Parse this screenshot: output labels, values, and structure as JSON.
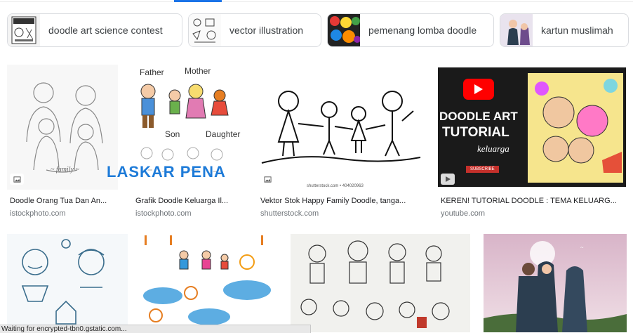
{
  "chips": [
    {
      "label": "doodle art science contest"
    },
    {
      "label": "vector illustration"
    },
    {
      "label": "pemenang lomba doodle"
    },
    {
      "label": "kartun muslimah"
    }
  ],
  "row1": [
    {
      "caption": "Doodle Orang Tua Dan An...",
      "source": "istockphoto.com",
      "badge": "image-icon"
    },
    {
      "caption": "Grafik Doodle Keluarga Il...",
      "source": "istockphoto.com",
      "overlay": "LASKAR PENA",
      "labels": {
        "father": "Father",
        "mother": "Mother",
        "son": "Son",
        "daughter": "Daughter"
      }
    },
    {
      "caption": "Vektor Stok Happy Family Doodle, tanga...",
      "source": "shutterstock.com",
      "badge": "image-icon",
      "stock_mark": "shutterstock.com • 404020963"
    },
    {
      "caption": "KEREN! TUTORIAL DOODLE : TEMA KELUARG...",
      "source": "youtube.com",
      "badge": "play-icon",
      "thumb": {
        "line1": "DOODLE ART",
        "line2": "TUTORIAL",
        "line3": "keluarga",
        "subscribe": "SUBSCRIBE"
      }
    }
  ],
  "status_text": "Waiting for encrypted-tbn0.gstatic.com...",
  "colors": {
    "accent": "#1a73e8",
    "youtube_red": "#ff0000",
    "status_bg": "#e8e8e8"
  }
}
